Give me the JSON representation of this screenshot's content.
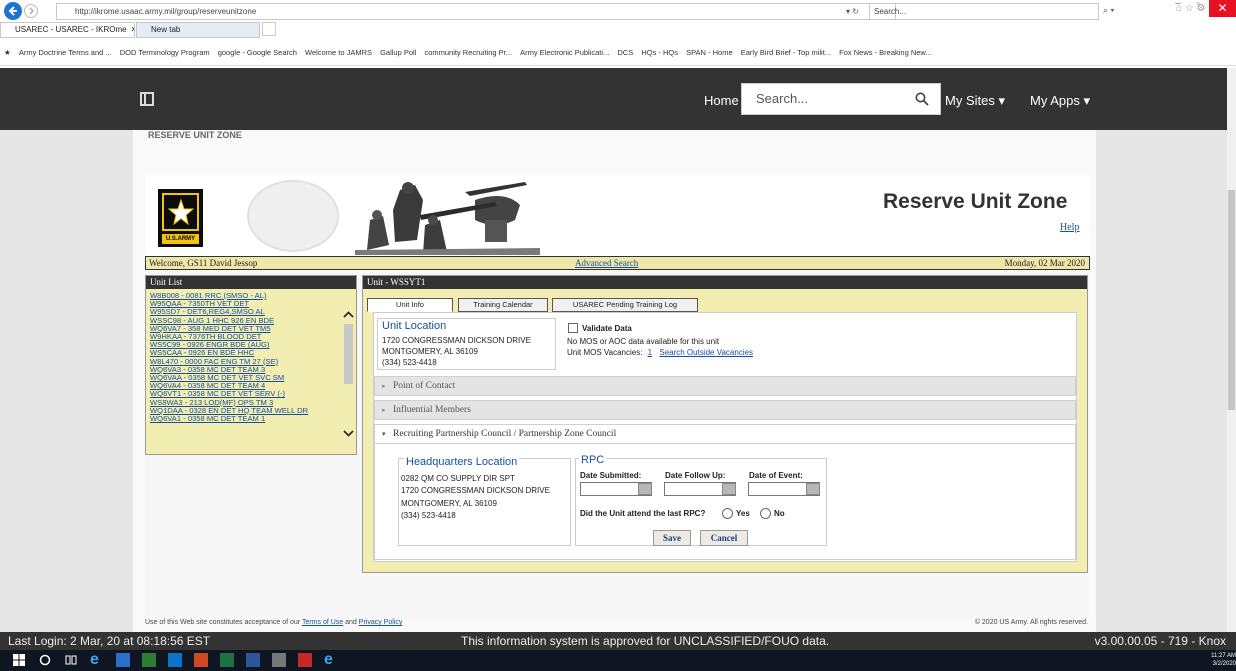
{
  "browser": {
    "address": "http://ikrome.usaac.army.mil/group/reserveunitzone",
    "search_placeholder": "Search...",
    "tabs": [
      {
        "label": "USAREC - USAREC - IKROme"
      },
      {
        "label": "New tab"
      }
    ],
    "favorites": [
      "Army Doctrine Terms and ...",
      "DOD Terminology Program",
      "google - Google Search",
      "Welcome to JAMRS",
      "Gallup Poll",
      "community Recruiting Pr...",
      "Army Electronic Publicati...",
      "DCS",
      "HQs - HQs",
      "SPAN - Home",
      "Early Bird Brief - Top milit...",
      "Fox News - Breaking New..."
    ]
  },
  "navbar": {
    "home": "Home",
    "search_placeholder": "Search...",
    "my_sites": "My Sites ▾",
    "my_apps": "My Apps ▾"
  },
  "zone_label": "RESERVE UNIT ZONE",
  "banner": {
    "title": "Reserve Unit Zone",
    "help": "Help",
    "logo_text": "U.S.ARMY"
  },
  "welcome_bar": {
    "welcome": "Welcome, GS11 David Jessop",
    "advanced_search": "Advanced Search",
    "date": "Monday, 02 Mar 2020"
  },
  "unit_list": {
    "title": "Unit List",
    "items": [
      "W8B008 - 0081 RRC (SMSO - AL)",
      "W95QAA - 7350TH VET DET",
      "W95SD7 - DET6,REG4,SMSO AL",
      "WSSC98 - AUG 1 HHC 926 EN BDE",
      "WQ6VA7 - 358 MED DET VET TM5",
      "W9HKAA - 7376TH BLOOD DET",
      "WS5C99 - 0926 ENGR BDE (AUG)",
      "WS5CAA - 0926 EN BDE HHC",
      "W8L470 - 0000 FAC ENG TM 27 (SE)",
      "WQ6VA3 - 0358 MC DET TEAM 3",
      "WQ6VAA - 0358 MC DET VET SVC SM",
      "WQ6VA4 - 0358 MC DET TEAM 4",
      "WQ6VT1 - 0358 MC DET VET SERV (-)",
      "WS8WA3 - 213 LOD(MF) OPS TM 3",
      "WQ1DAA - 0328 EN DET HQ TEAM WELL DR",
      "WQ6VA1 - 0358 MC DET TEAM 1"
    ]
  },
  "unit_panel": {
    "title": "Unit - WSSYT1",
    "tabs": [
      "Unit Info",
      "Training Calendar",
      "USAREC Pending Training Log"
    ],
    "unit_location_heading": "Unit Location",
    "unit_location_lines": [
      "1720 CONGRESSMAN DICKSON DRIVE",
      "MONTGOMERY, AL 36109",
      "(334) 523-4418"
    ],
    "validate_label": "Validate Data",
    "no_mos_text": "No MOS or AOC data available for this unit",
    "vacancies_label": "Unit MOS Vacancies:",
    "vacancies_count": "1",
    "search_outside": "Search Outside Vacancies",
    "sections": [
      "Point of Contact",
      "Influential Members",
      "Recruiting Partnership Council / Partnership Zone Council"
    ],
    "hq_heading": "Headquarters Location",
    "hq_lines": [
      "0282 QM CO SUPPLY DIR SPT",
      "1720 CONGRESSMAN DICKSON DRIVE",
      "MONTGOMERY, AL 36109",
      "(334) 523-4418"
    ],
    "rpc_heading": "RPC",
    "date_submitted": "Date Submitted:",
    "date_follow_up": "Date Follow Up:",
    "date_of_event": "Date of Event:",
    "attend_question": "Did the Unit attend the last RPC?",
    "yes": "Yes",
    "no": "No",
    "save": "Save",
    "cancel": "Cancel"
  },
  "footer": {
    "prefix": "Use of this Web site constitutes acceptance of our",
    "terms": "Terms of Use",
    "and": "and",
    "privacy": "Privacy Policy",
    "copyright": "© 2020 US Army. All rights reserved."
  },
  "status_bar": {
    "last_login": "Last Login: 2 Mar, 20 at 08:18:56 EST",
    "classification": "This information system is approved for UNCLASSIFIED/FOUO data.",
    "version": "v3.00.00.05 - 719 - Knox"
  },
  "taskbar": {
    "time": "11:27 AM",
    "date": "3/2/2020"
  },
  "colors": {
    "navbar": "#333333",
    "panel_yellow": "#f2edb0",
    "link_blue": "#1a4fa0"
  }
}
